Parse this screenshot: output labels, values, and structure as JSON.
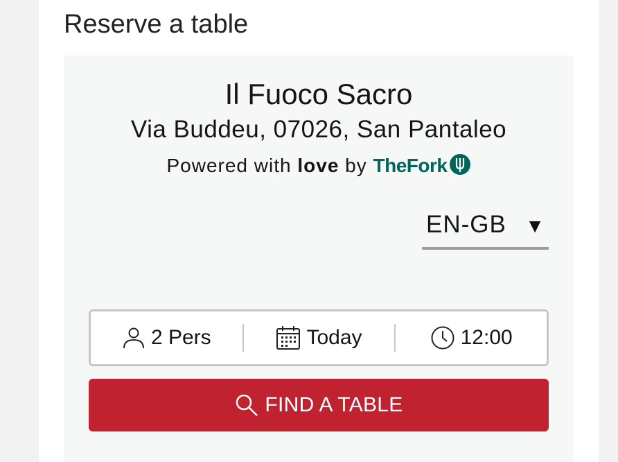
{
  "section": {
    "title": "Reserve a table"
  },
  "restaurant": {
    "name": "Il Fuoco Sacro",
    "address": "Via Buddeu, 07026, San Pantaleo"
  },
  "powered": {
    "prefix": "Powered with",
    "love": "love",
    "by": "by",
    "brand": "TheFork"
  },
  "language": {
    "selected": "EN-GB",
    "arrow": "▼"
  },
  "booking": {
    "persons": {
      "label": "2 Pers",
      "icon": "person-icon"
    },
    "date": {
      "label": "Today",
      "icon": "calendar-icon"
    },
    "time": {
      "label": "12:00",
      "icon": "clock-icon"
    }
  },
  "find_button": {
    "label": "FIND A TABLE",
    "icon": "search-icon"
  },
  "colors": {
    "brand_green": "#00665c",
    "button_red": "#c0222f",
    "widget_bg": "#f6f7f7"
  }
}
